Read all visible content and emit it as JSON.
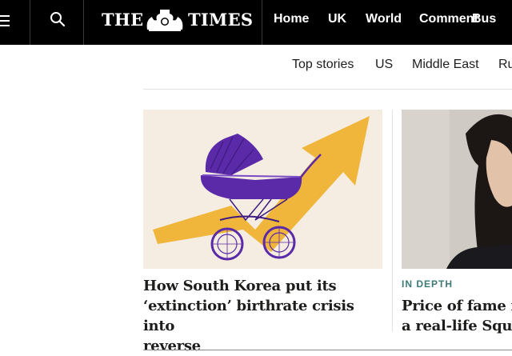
{
  "header": {
    "logo_left": "THE",
    "logo_right": "TIMES",
    "menu_icon": "hamburger-icon",
    "search_icon": "search-icon",
    "nav": [
      "Home",
      "UK",
      "World",
      "Comment",
      "Bus"
    ]
  },
  "subnav": [
    "Top stories",
    "US",
    "Middle East",
    "Ru"
  ],
  "stories": [
    {
      "headline_lines": [
        "How South Korea put its",
        "‘extinction’ birthrate crisis into",
        "reverse"
      ],
      "image": "pram-on-rising-arrow-illustration"
    },
    {
      "kicker": "IN DEPTH",
      "headline_lines": [
        "Price of fame in",
        "a real-life Squid"
      ],
      "image": "woman-portrait-photo"
    }
  ],
  "colors": {
    "topbar": "#000000",
    "kicker": "#3c7a78",
    "arrow": "#f0b63c",
    "pram": "#5a2aa8",
    "illustration_bg": "#f5ede2"
  }
}
